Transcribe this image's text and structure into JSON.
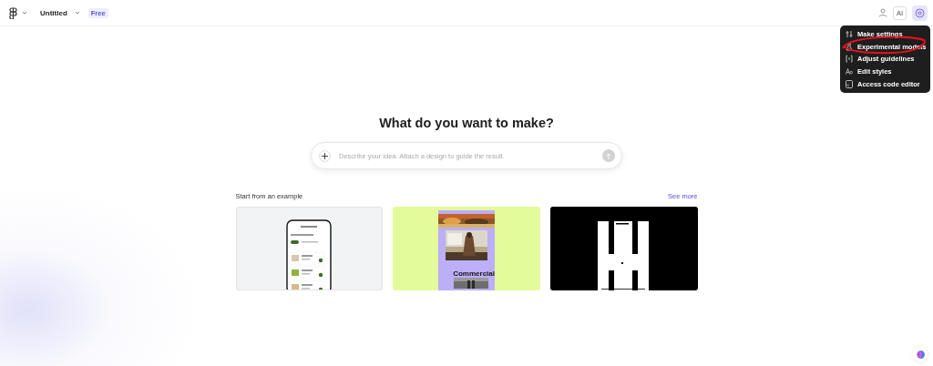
{
  "topbar": {
    "file_name": "Untitled",
    "plan_badge": "Free",
    "ai_label": "AI"
  },
  "menu": {
    "items": [
      {
        "label": "Make settings"
      },
      {
        "label": "Experimental models"
      },
      {
        "label": "Adjust guidelines"
      },
      {
        "label": "Edit styles"
      },
      {
        "label": "Access code editor"
      }
    ]
  },
  "annotation": {
    "kind": "ellipse",
    "color": "#e0131b"
  },
  "heading": "What do you want to make?",
  "prompt": {
    "placeholder": "Describe your idea. Attach a design to guide the result."
  },
  "examples": {
    "title": "Start from an example",
    "link": "See more",
    "cards": [
      {
        "kind": "phone"
      },
      {
        "kind": "poster",
        "text": "Commercial"
      },
      {
        "kind": "game"
      }
    ]
  }
}
